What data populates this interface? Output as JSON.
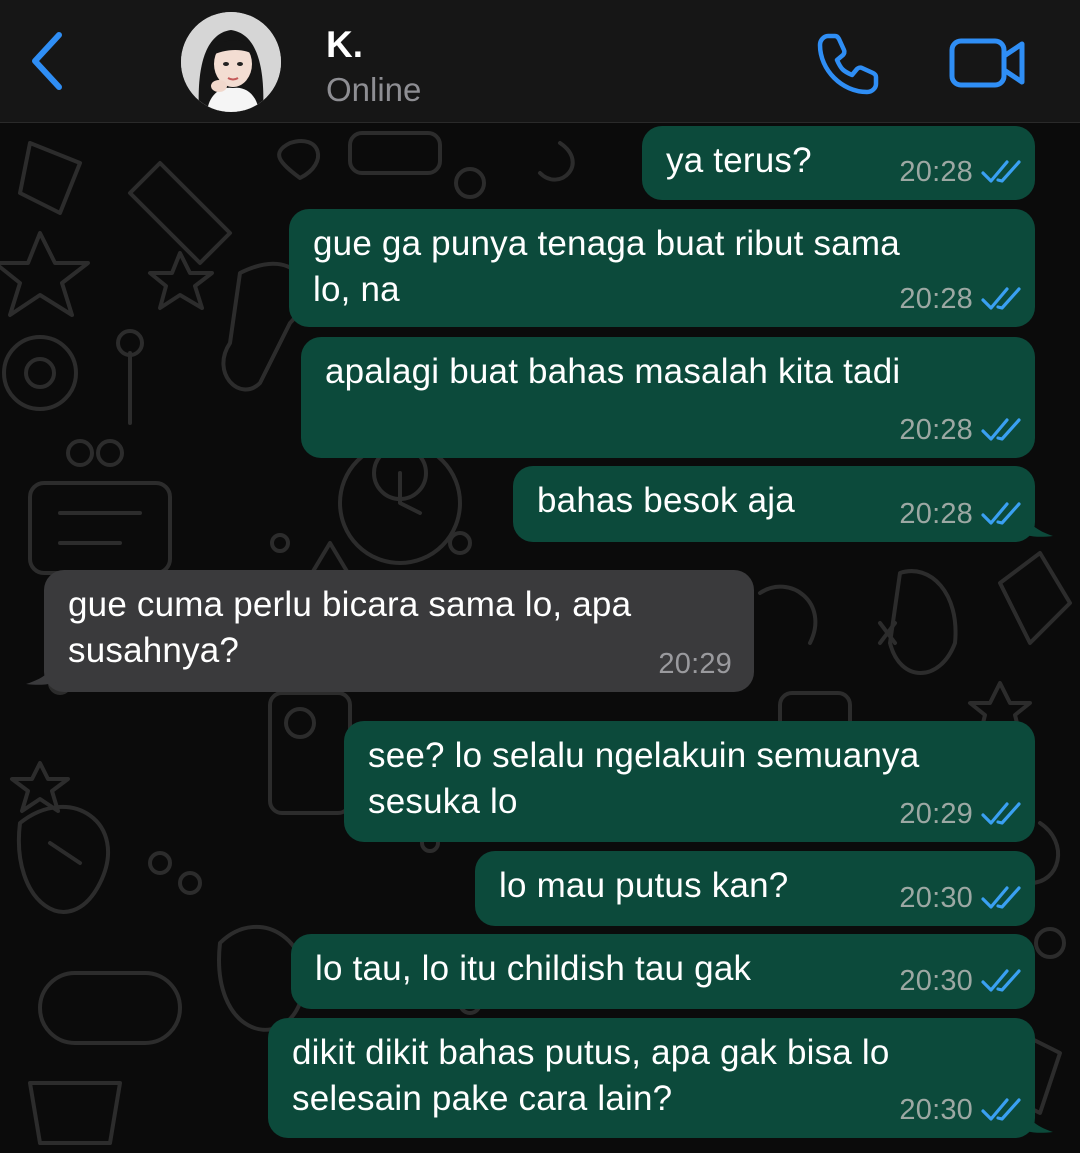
{
  "header": {
    "back_icon": "chevron-left-icon",
    "contact_name": "K.",
    "status": "Online",
    "call_icon": "phone-icon",
    "video_icon": "video-camera-icon",
    "accent_color": "#2f8ef5"
  },
  "colors": {
    "outgoing_bubble": "#0c4a3b",
    "incoming_bubble": "#3a3a3c",
    "read_ticks": "#3aa0f2"
  },
  "messages": [
    {
      "direction": "outgoing",
      "text": "ya terus?",
      "time": "20:28",
      "read": true
    },
    {
      "direction": "outgoing",
      "text": "gue ga punya tenaga buat ribut sama\nlo, na",
      "time": "20:28",
      "read": true
    },
    {
      "direction": "outgoing",
      "text": "apalagi buat bahas masalah kita tadi",
      "time": "20:28",
      "read": true
    },
    {
      "direction": "outgoing",
      "text": "bahas besok aja",
      "time": "20:28",
      "read": true
    },
    {
      "direction": "incoming",
      "text": "gue cuma perlu bicara sama lo, apa\nsusahnya?",
      "time": "20:29"
    },
    {
      "direction": "outgoing",
      "text": "see? lo selalu ngelakuin semuanya\nsesuka lo",
      "time": "20:29",
      "read": true
    },
    {
      "direction": "outgoing",
      "text": "lo mau putus kan?",
      "time": "20:30",
      "read": true
    },
    {
      "direction": "outgoing",
      "text": "lo tau, lo itu childish tau gak",
      "time": "20:30",
      "read": true
    },
    {
      "direction": "outgoing",
      "text": "dikit dikit bahas putus, apa gak bisa lo\nselesain pake cara lain?",
      "time": "20:30",
      "read": true
    }
  ]
}
